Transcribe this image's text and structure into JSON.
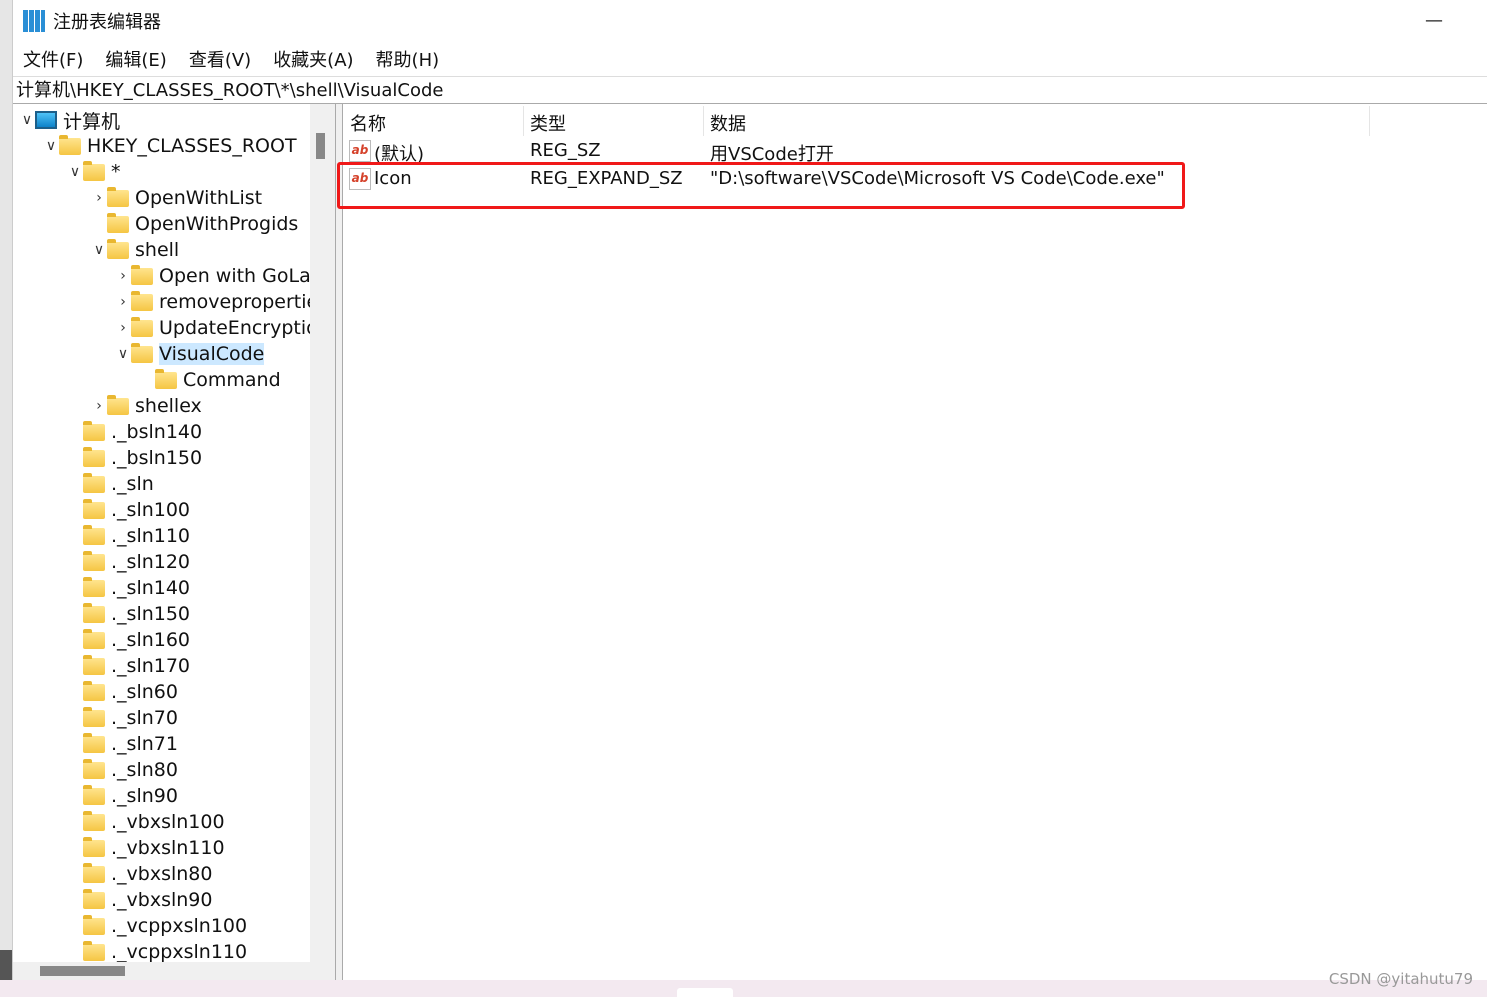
{
  "window": {
    "title": "注册表编辑器",
    "minimize": "—"
  },
  "menu": [
    "文件(F)",
    "编辑(E)",
    "查看(V)",
    "收藏夹(A)",
    "帮助(H)"
  ],
  "address": "计算机\\HKEY_CLASSES_ROOT\\*\\shell\\VisualCode",
  "tree": [
    {
      "label": "计算机",
      "level": 0,
      "state": "open",
      "icon": "computer-icon"
    },
    {
      "label": "HKEY_CLASSES_ROOT",
      "level": 1,
      "state": "open"
    },
    {
      "label": "*",
      "level": 2,
      "state": "open"
    },
    {
      "label": "OpenWithList",
      "level": 3,
      "state": "closed"
    },
    {
      "label": "OpenWithProgids",
      "level": 3,
      "state": "none"
    },
    {
      "label": "shell",
      "level": 3,
      "state": "open"
    },
    {
      "label": "Open with GoLand",
      "level": 4,
      "state": "closed"
    },
    {
      "label": "removeproperties",
      "level": 4,
      "state": "closed"
    },
    {
      "label": "UpdateEncryption",
      "level": 4,
      "state": "closed"
    },
    {
      "label": "VisualCode",
      "level": 4,
      "state": "open",
      "selected": true
    },
    {
      "label": "Command",
      "level": 5,
      "state": "none"
    },
    {
      "label": "shellex",
      "level": 3,
      "state": "closed"
    },
    {
      "label": "._bsln140",
      "level": 2,
      "state": "none"
    },
    {
      "label": "._bsln150",
      "level": 2,
      "state": "none"
    },
    {
      "label": "._sln",
      "level": 2,
      "state": "none"
    },
    {
      "label": "._sln100",
      "level": 2,
      "state": "none"
    },
    {
      "label": "._sln110",
      "level": 2,
      "state": "none"
    },
    {
      "label": "._sln120",
      "level": 2,
      "state": "none"
    },
    {
      "label": "._sln140",
      "level": 2,
      "state": "none"
    },
    {
      "label": "._sln150",
      "level": 2,
      "state": "none"
    },
    {
      "label": "._sln160",
      "level": 2,
      "state": "none"
    },
    {
      "label": "._sln170",
      "level": 2,
      "state": "none"
    },
    {
      "label": "._sln60",
      "level": 2,
      "state": "none"
    },
    {
      "label": "._sln70",
      "level": 2,
      "state": "none"
    },
    {
      "label": "._sln71",
      "level": 2,
      "state": "none"
    },
    {
      "label": "._sln80",
      "level": 2,
      "state": "none"
    },
    {
      "label": "._sln90",
      "level": 2,
      "state": "none"
    },
    {
      "label": "._vbxsln100",
      "level": 2,
      "state": "none"
    },
    {
      "label": "._vbxsln110",
      "level": 2,
      "state": "none"
    },
    {
      "label": "._vbxsln80",
      "level": 2,
      "state": "none"
    },
    {
      "label": "._vbxsln90",
      "level": 2,
      "state": "none"
    },
    {
      "label": "._vcppxsln100",
      "level": 2,
      "state": "none"
    },
    {
      "label": "._vcppxsln110",
      "level": 2,
      "state": "none"
    }
  ],
  "list": {
    "headers": {
      "name": "名称",
      "type": "类型",
      "data": "数据"
    },
    "rows": [
      {
        "name": "(默认)",
        "type": "REG_SZ",
        "data": "用VSCode打开",
        "icon": "ab"
      },
      {
        "name": "Icon",
        "type": "REG_EXPAND_SZ",
        "data": "\"D:\\software\\VSCode\\Microsoft VS Code\\Code.exe\"",
        "icon": "ab",
        "highlighted": true
      }
    ]
  },
  "highlight_color": "#f01818",
  "watermark": "CSDN @yitahutu79"
}
